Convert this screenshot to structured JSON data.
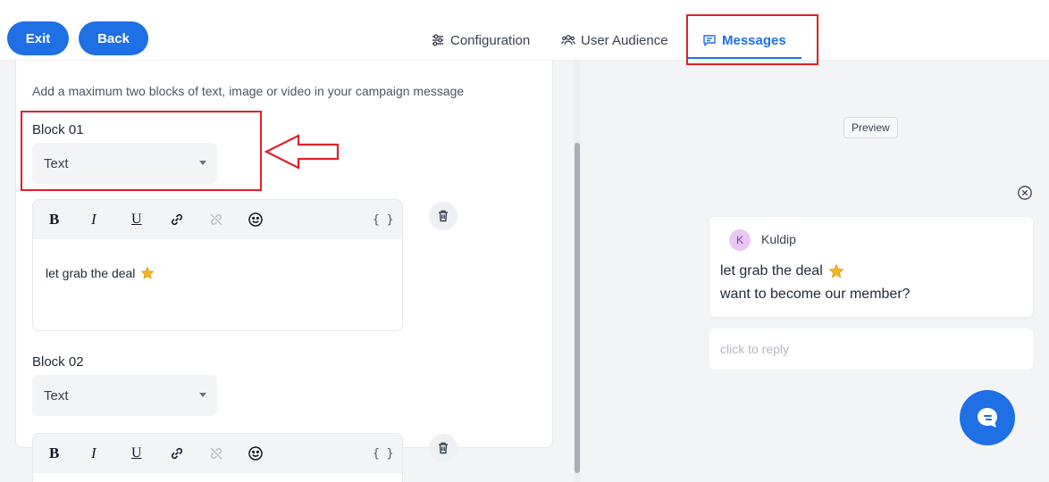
{
  "header": {
    "exit_label": "Exit",
    "back_label": "Back",
    "tabs": [
      {
        "label": "Configuration",
        "icon": "sliders-icon"
      },
      {
        "label": "User Audience",
        "icon": "users-icon"
      },
      {
        "label": "Messages",
        "icon": "message-icon",
        "active": true
      }
    ],
    "accent_color": "#1f6fe5"
  },
  "editor": {
    "intro": "Add a maximum two blocks of text, image or video in your campaign message",
    "blocks": [
      {
        "label": "Block 01",
        "type": "Text",
        "content": "let grab the deal"
      },
      {
        "label": "Block 02",
        "type": "Text",
        "content": ""
      }
    ],
    "toolbar": {
      "bold": "B",
      "italic": "I",
      "underline": "U",
      "variables": "{ }"
    }
  },
  "preview": {
    "badge": "Preview",
    "sender_initial": "K",
    "sender_name": "Kuldip",
    "message_line_1": "let grab the deal",
    "message_line_2": "want to become our member?",
    "reply_placeholder": "click to reply"
  },
  "annotation_color": "#e0202a"
}
